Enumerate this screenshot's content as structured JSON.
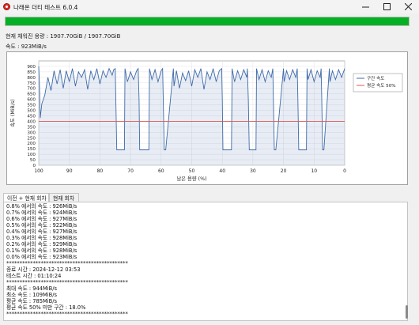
{
  "window": {
    "title": "나래온 더티 테스트 6.0.4",
    "minimize_icon": "minimize-icon",
    "maximize_icon": "maximize-icon",
    "close_icon": "close-icon"
  },
  "progress": {
    "fraction": 1.0,
    "color": "#06b025"
  },
  "info": {
    "capacity_line": "현재 채워진 용량 : 1907.70GiB / 1907.70GiB",
    "speed_line": "속도 : 923MiB/s"
  },
  "chart_data": {
    "type": "line",
    "xlabel": "남은 용량 (%)",
    "ylabel": "속도 (MiB/s)",
    "xlim": [
      100,
      0
    ],
    "ylim": [
      0,
      950
    ],
    "x_ticks": [
      100,
      90,
      80,
      70,
      60,
      50,
      40,
      30,
      20,
      10,
      0
    ],
    "x_tick_labels": [
      "100",
      "90",
      "80",
      "70",
      "60",
      "50",
      "40",
      "30",
      "20",
      "10",
      "0"
    ],
    "y_ticks": [
      0,
      50,
      100,
      150,
      200,
      250,
      300,
      350,
      400,
      450,
      500,
      550,
      600,
      650,
      700,
      750,
      800,
      850,
      900
    ],
    "y_tick_labels": [
      "0",
      "50",
      "100",
      "150",
      "200",
      "250",
      "300",
      "350",
      "400",
      "450",
      "500",
      "550",
      "600",
      "650",
      "700",
      "750",
      "800",
      "850",
      "900"
    ],
    "grid": true,
    "legend_position": "right",
    "series": [
      {
        "name": "구간 속도",
        "color": "#3f6aaa",
        "x": [
          100,
          99.8,
          99.5,
          99,
          98,
          97,
          96,
          95,
          94,
          93,
          92,
          91,
          90,
          89,
          88,
          87,
          86,
          85,
          84,
          83,
          82,
          81,
          80,
          79,
          78,
          77,
          76,
          75.5,
          75,
          74.8,
          74.5,
          72,
          71.8,
          71,
          70,
          69,
          68,
          67.5,
          67.2,
          67,
          66.8,
          66.5,
          64,
          63.8,
          63,
          62,
          61,
          60,
          59.5,
          59.3,
          59,
          58.8,
          58.5,
          56,
          55.8,
          55,
          54,
          53,
          52,
          51,
          50,
          49,
          48,
          47,
          46,
          45,
          44,
          43,
          42,
          41,
          40.2,
          40,
          39.8,
          39.5,
          37,
          36.8,
          36,
          35,
          34,
          33,
          32,
          31.8,
          31.5,
          31.2,
          31,
          30.8,
          29,
          28.8,
          28,
          27,
          26,
          25,
          24,
          23.5,
          23.3,
          23,
          22.8,
          22.5,
          20,
          19.8,
          19,
          18,
          17,
          16,
          15.5,
          15.3,
          15,
          14.8,
          14.5,
          12.5,
          12.3,
          12,
          11,
          10,
          9,
          8,
          7.7,
          7.5,
          7.2,
          7,
          6.8,
          5,
          4.8,
          4,
          3,
          2,
          1,
          0
        ],
        "y": [
          900,
          750,
          430,
          560,
          640,
          800,
          680,
          860,
          740,
          870,
          700,
          860,
          760,
          880,
          720,
          850,
          800,
          870,
          690,
          860,
          780,
          880,
          740,
          860,
          800,
          880,
          820,
          870,
          880,
          600,
          140,
          140,
          880,
          760,
          850,
          780,
          860,
          880,
          600,
          140,
          140,
          140,
          140,
          880,
          780,
          870,
          760,
          860,
          880,
          600,
          140,
          140,
          140,
          880,
          720,
          860,
          700,
          840,
          770,
          860,
          720,
          870,
          800,
          880,
          690,
          850,
          780,
          880,
          760,
          860,
          880,
          600,
          140,
          140,
          140,
          880,
          760,
          860,
          780,
          870,
          800,
          880,
          600,
          140,
          140,
          140,
          140,
          880,
          780,
          870,
          760,
          860,
          800,
          880,
          600,
          140,
          140,
          140,
          880,
          760,
          860,
          780,
          870,
          800,
          880,
          600,
          140,
          140,
          140,
          140,
          880,
          780,
          870,
          760,
          860,
          800,
          880,
          600,
          140,
          140,
          140,
          880,
          760,
          860,
          780,
          870,
          800,
          880
        ]
      },
      {
        "name": "평균 속도 50%",
        "color": "#e05555",
        "x": [
          100,
          0
        ],
        "y": [
          400,
          400
        ]
      }
    ]
  },
  "tabs": [
    {
      "label": "이전 + 현재 회차"
    },
    {
      "label": "현재 회차"
    }
  ],
  "log_lines": [
    "0.8% 에서의 속도 : 926MiB/s",
    "0.7% 에서의 속도 : 924MiB/s",
    "0.6% 에서의 속도 : 927MiB/s",
    "0.5% 에서의 속도 : 922MiB/s",
    "0.4% 에서의 속도 : 927MiB/s",
    "0.3% 에서의 속도 : 928MiB/s",
    "0.2% 에서의 속도 : 929MiB/s",
    "0.1% 에서의 속도 : 928MiB/s",
    "0.0% 에서의 속도 : 923MiB/s",
    "**********************************************",
    "종료 시간 : 2024-12-12 03:53",
    "테스트 시간 : 01:10:24",
    "**********************************************",
    "최대 속도 : 944MiB/s",
    "최소 속도 : 109MiB/s",
    "평균 속도 : 785MiB/s",
    "평균 속도 50% 미만 구간 : 18.0%",
    "**********************************************"
  ]
}
